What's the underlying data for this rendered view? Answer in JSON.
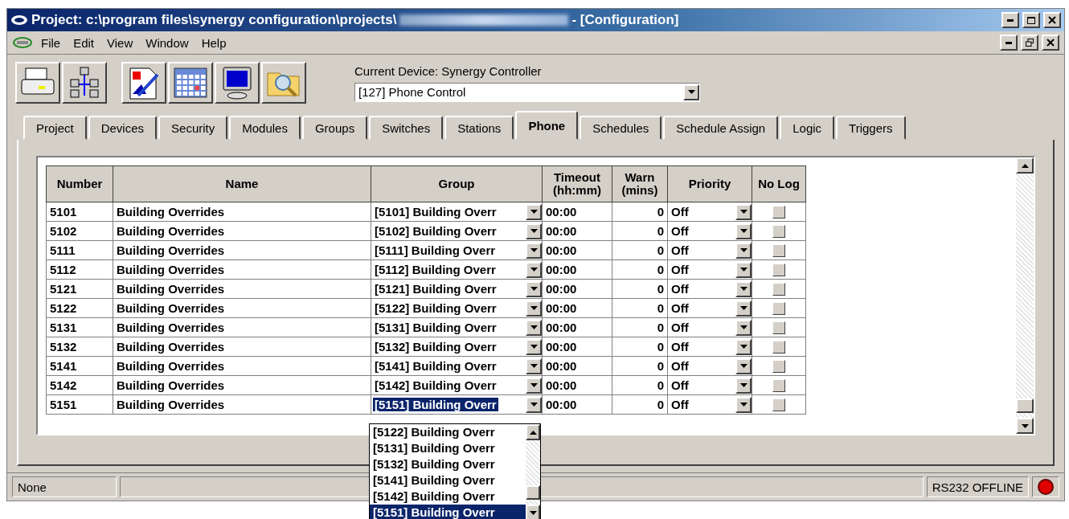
{
  "window": {
    "title": "Project: c:\\program files\\synergy configuration\\projects\\",
    "title_suffix": "- [Configuration]"
  },
  "menu": [
    "File",
    "Edit",
    "View",
    "Window",
    "Help"
  ],
  "toolbar": {
    "device_label": "Current Device: Synergy Controller",
    "device_value": "[127] Phone Control"
  },
  "tabs": [
    {
      "label": "Project",
      "selected": false
    },
    {
      "label": "Devices",
      "selected": false
    },
    {
      "label": "Security",
      "selected": false
    },
    {
      "label": "Modules",
      "selected": false
    },
    {
      "label": "Groups",
      "selected": false
    },
    {
      "label": "Switches",
      "selected": false
    },
    {
      "label": "Stations",
      "selected": false
    },
    {
      "label": "Phone",
      "selected": true
    },
    {
      "label": "Schedules",
      "selected": false
    },
    {
      "label": "Schedule Assign",
      "selected": false
    },
    {
      "label": "Logic",
      "selected": false
    },
    {
      "label": "Triggers",
      "selected": false
    }
  ],
  "table": {
    "columns": [
      "Number",
      "Name",
      "Group",
      "Timeout (hh:mm)",
      "Warn (mins)",
      "Priority",
      "No Log"
    ],
    "rows": [
      {
        "number": "5101",
        "name": "Building Overrides",
        "group": "[5101] Building Overr",
        "group_selected": false,
        "timeout": "00:00",
        "warn": "0",
        "priority": "Off",
        "no_log": false
      },
      {
        "number": "5102",
        "name": "Building Overrides",
        "group": "[5102] Building Overr",
        "group_selected": false,
        "timeout": "00:00",
        "warn": "0",
        "priority": "Off",
        "no_log": false
      },
      {
        "number": "5111",
        "name": "Building Overrides",
        "group": "[5111] Building Overr",
        "group_selected": false,
        "timeout": "00:00",
        "warn": "0",
        "priority": "Off",
        "no_log": false
      },
      {
        "number": "5112",
        "name": "Building Overrides",
        "group": "[5112] Building Overr",
        "group_selected": false,
        "timeout": "00:00",
        "warn": "0",
        "priority": "Off",
        "no_log": false
      },
      {
        "number": "5121",
        "name": "Building Overrides",
        "group": "[5121] Building Overr",
        "group_selected": false,
        "timeout": "00:00",
        "warn": "0",
        "priority": "Off",
        "no_log": false
      },
      {
        "number": "5122",
        "name": "Building Overrides",
        "group": "[5122] Building Overr",
        "group_selected": false,
        "timeout": "00:00",
        "warn": "0",
        "priority": "Off",
        "no_log": false
      },
      {
        "number": "5131",
        "name": "Building Overrides",
        "group": "[5131] Building Overr",
        "group_selected": false,
        "timeout": "00:00",
        "warn": "0",
        "priority": "Off",
        "no_log": false
      },
      {
        "number": "5132",
        "name": "Building Overrides",
        "group": "[5132] Building Overr",
        "group_selected": false,
        "timeout": "00:00",
        "warn": "0",
        "priority": "Off",
        "no_log": false
      },
      {
        "number": "5141",
        "name": "Building Overrides",
        "group": "[5141] Building Overr",
        "group_selected": false,
        "timeout": "00:00",
        "warn": "0",
        "priority": "Off",
        "no_log": false
      },
      {
        "number": "5142",
        "name": "Building Overrides",
        "group": "[5142] Building Overr",
        "group_selected": false,
        "timeout": "00:00",
        "warn": "0",
        "priority": "Off",
        "no_log": false
      },
      {
        "number": "5151",
        "name": "Building Overrides",
        "group": "[5151] Building Overr",
        "group_selected": true,
        "timeout": "00:00",
        "warn": "0",
        "priority": "Off",
        "no_log": false
      }
    ]
  },
  "dropdown": [
    {
      "label": "[5122] Building Overr",
      "selected": false
    },
    {
      "label": "[5131] Building Overr",
      "selected": false
    },
    {
      "label": "[5132] Building Overr",
      "selected": false
    },
    {
      "label": "[5141] Building Overr",
      "selected": false
    },
    {
      "label": "[5142] Building Overr",
      "selected": false
    },
    {
      "label": "[5151] Building Overr",
      "selected": true
    }
  ],
  "status_bar": {
    "left": "None",
    "connection": "RS232 OFFLINE",
    "online": false
  }
}
